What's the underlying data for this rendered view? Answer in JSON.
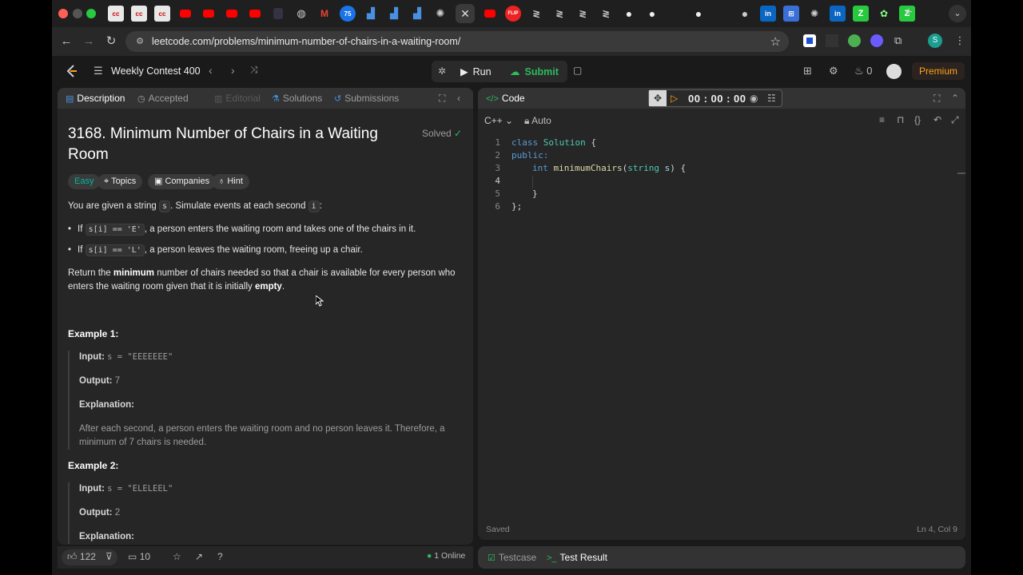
{
  "browser": {
    "url": "leetcode.com/problems/minimum-number-of-chairs-in-a-waiting-room/",
    "profile_initial": "S",
    "tab_labels": [
      "cc",
      "cc",
      "cc",
      "75",
      "FLIP"
    ]
  },
  "nav": {
    "contest_title": "Weekly Contest 400",
    "run_label": "Run",
    "submit_label": "Submit",
    "streak_count": "0",
    "premium_label": "Premium"
  },
  "left_tabs": {
    "description": "Description",
    "accepted": "Accepted",
    "editorial": "Editorial",
    "solutions": "Solutions",
    "submissions": "Submissions"
  },
  "problem": {
    "title": "3168. Minimum Number of Chairs in a Waiting Room",
    "status": "Solved",
    "difficulty": "Easy",
    "chips": {
      "topics": "Topics",
      "companies": "Companies",
      "hint": "Hint"
    },
    "intro_pre": "You are given a string",
    "intro_var_s": "s",
    "intro_mid": ". Simulate events at each second",
    "intro_var_i": "i",
    "intro_post": ":",
    "bullets": [
      {
        "pre": "If",
        "code": "s[i] == 'E'",
        "post": ", a person enters the waiting room and takes one of the chairs in it."
      },
      {
        "pre": "If",
        "code": "s[i] == 'L'",
        "post": ", a person leaves the waiting room, freeing up a chair."
      }
    ],
    "return_pre": "Return the",
    "return_bold1": "minimum",
    "return_mid": "number of chairs needed so that a chair is available for every person who enters the waiting room given that it is initially",
    "return_bold2": "empty",
    "return_post": ".",
    "examples": [
      {
        "heading": "Example 1:",
        "input_label": "Input:",
        "input": "s = \"EEEEEEE\"",
        "output_label": "Output:",
        "output": "7",
        "explanation_label": "Explanation:",
        "explanation": "After each second, a person enters the waiting room and no person leaves it. Therefore, a minimum of 7 chairs is needed."
      },
      {
        "heading": "Example 2:",
        "input_label": "Input:",
        "input": "s = \"ELELEEL\"",
        "output_label": "Output:",
        "output": "2",
        "explanation_label": "Explanation:"
      }
    ]
  },
  "footer": {
    "likes": "122",
    "comments": "10",
    "online": "1 Online"
  },
  "code_panel": {
    "title": "Code",
    "timer": "00 : 00 : 00",
    "language": "C++",
    "mode": "Auto",
    "line_numbers": [
      "1",
      "2",
      "3",
      "4",
      "5",
      "6"
    ],
    "lines": {
      "l1_kw": "class",
      "l1_ty": "Solution",
      "l1_rest": " {",
      "l2_kw": "public:",
      "l3_kw": "int",
      "l3_fn": "minimumChairs",
      "l3_p1": "(",
      "l3_ty": "string",
      "l3_pm": " s",
      "l3_rest": ") {",
      "l5": "}",
      "l6": "};"
    },
    "saved": "Saved",
    "cursor": "Ln 4, Col 9"
  },
  "bottom_tabs": {
    "testcase": "Testcase",
    "test_result": "Test Result"
  },
  "colors": {
    "accent": "#ffa116",
    "easy": "#00b8a3",
    "submit": "#2cbb5d",
    "solved": "#2cbb5d"
  }
}
